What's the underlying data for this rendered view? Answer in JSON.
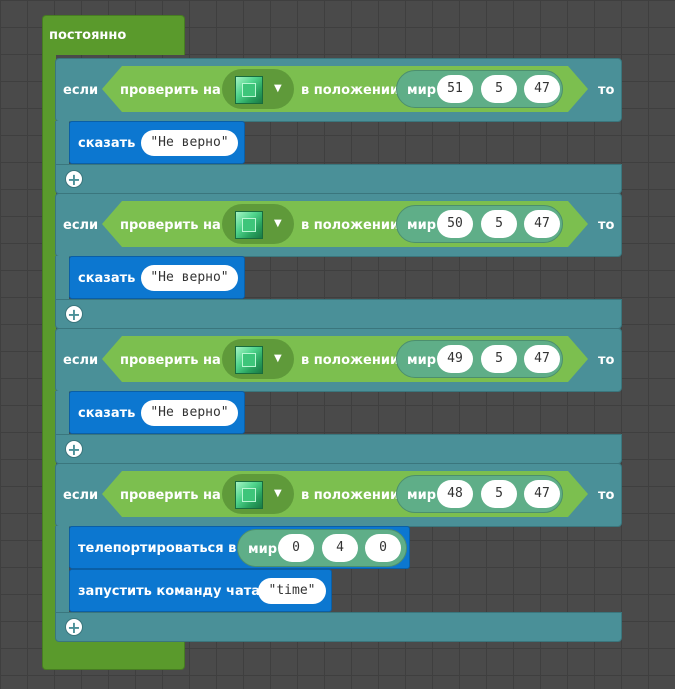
{
  "forever": {
    "label": "постоянно"
  },
  "if_blocks": [
    {
      "if_label": "если",
      "check_label": "проверить на",
      "at_label": "в положении",
      "world_label": "мир",
      "coords": [
        "51",
        "5",
        "47"
      ],
      "then_label": "то",
      "action_label": "сказать",
      "action_value": "\"Не верно\""
    },
    {
      "if_label": "если",
      "check_label": "проверить на",
      "at_label": "в положении",
      "world_label": "мир",
      "coords": [
        "50",
        "5",
        "47"
      ],
      "then_label": "то",
      "action_label": "сказать",
      "action_value": "\"Не верно\""
    },
    {
      "if_label": "если",
      "check_label": "проверить на",
      "at_label": "в положении",
      "world_label": "мир",
      "coords": [
        "49",
        "5",
        "47"
      ],
      "then_label": "то",
      "action_label": "сказать",
      "action_value": "\"Не верно\""
    },
    {
      "if_label": "если",
      "check_label": "проверить на",
      "at_label": "в положении",
      "world_label": "мир",
      "coords": [
        "48",
        "5",
        "47"
      ],
      "then_label": "то"
    }
  ],
  "teleport": {
    "label": "телепортироваться в",
    "world_label": "мир",
    "coords": [
      "0",
      "4",
      "0"
    ]
  },
  "chat_command": {
    "label": "запустить команду чата",
    "value": "\"time\""
  },
  "icons": {
    "block": "emerald-block-icon",
    "add": "plus-icon",
    "dropdown": "caret-down-icon"
  },
  "colors": {
    "loops": "#5a9a2c",
    "logic": "#4a9098",
    "condition": "#7cbf4f",
    "player": "#0c77d0",
    "position": "#5fae88"
  }
}
